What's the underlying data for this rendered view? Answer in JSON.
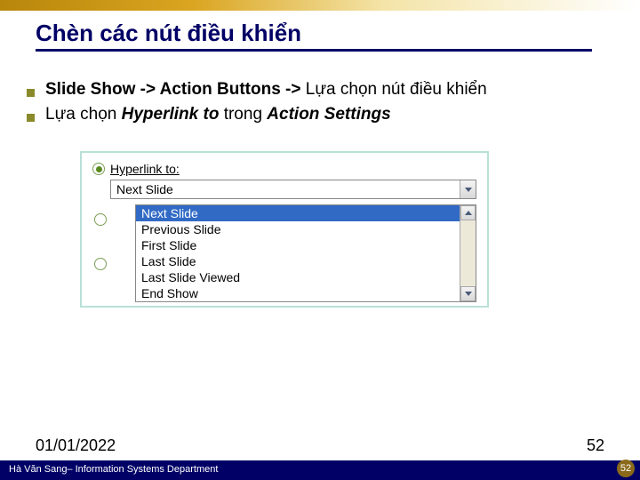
{
  "title": "Chèn các nút điều khiển",
  "bullets": [
    {
      "bold1": "Slide Show -> Action Buttons -> ",
      "plain": "Lựa chọn nút điều khiển"
    },
    {
      "plain1": "Lựa chọn ",
      "italic1": "Hyperlink to ",
      "plain2": "trong ",
      "italic2": "Action Settings"
    }
  ],
  "dialog": {
    "radio_label": "Hyperlink to:",
    "combo_value": "Next Slide",
    "list": [
      "Next Slide",
      "Previous Slide",
      "First Slide",
      "Last Slide",
      "Last Slide Viewed",
      "End Show"
    ],
    "selected_index": 0
  },
  "footer": {
    "date": "01/01/2022",
    "page": "52",
    "credit": "Hà Văn Sang– Information Systems Department",
    "badge": "52"
  }
}
